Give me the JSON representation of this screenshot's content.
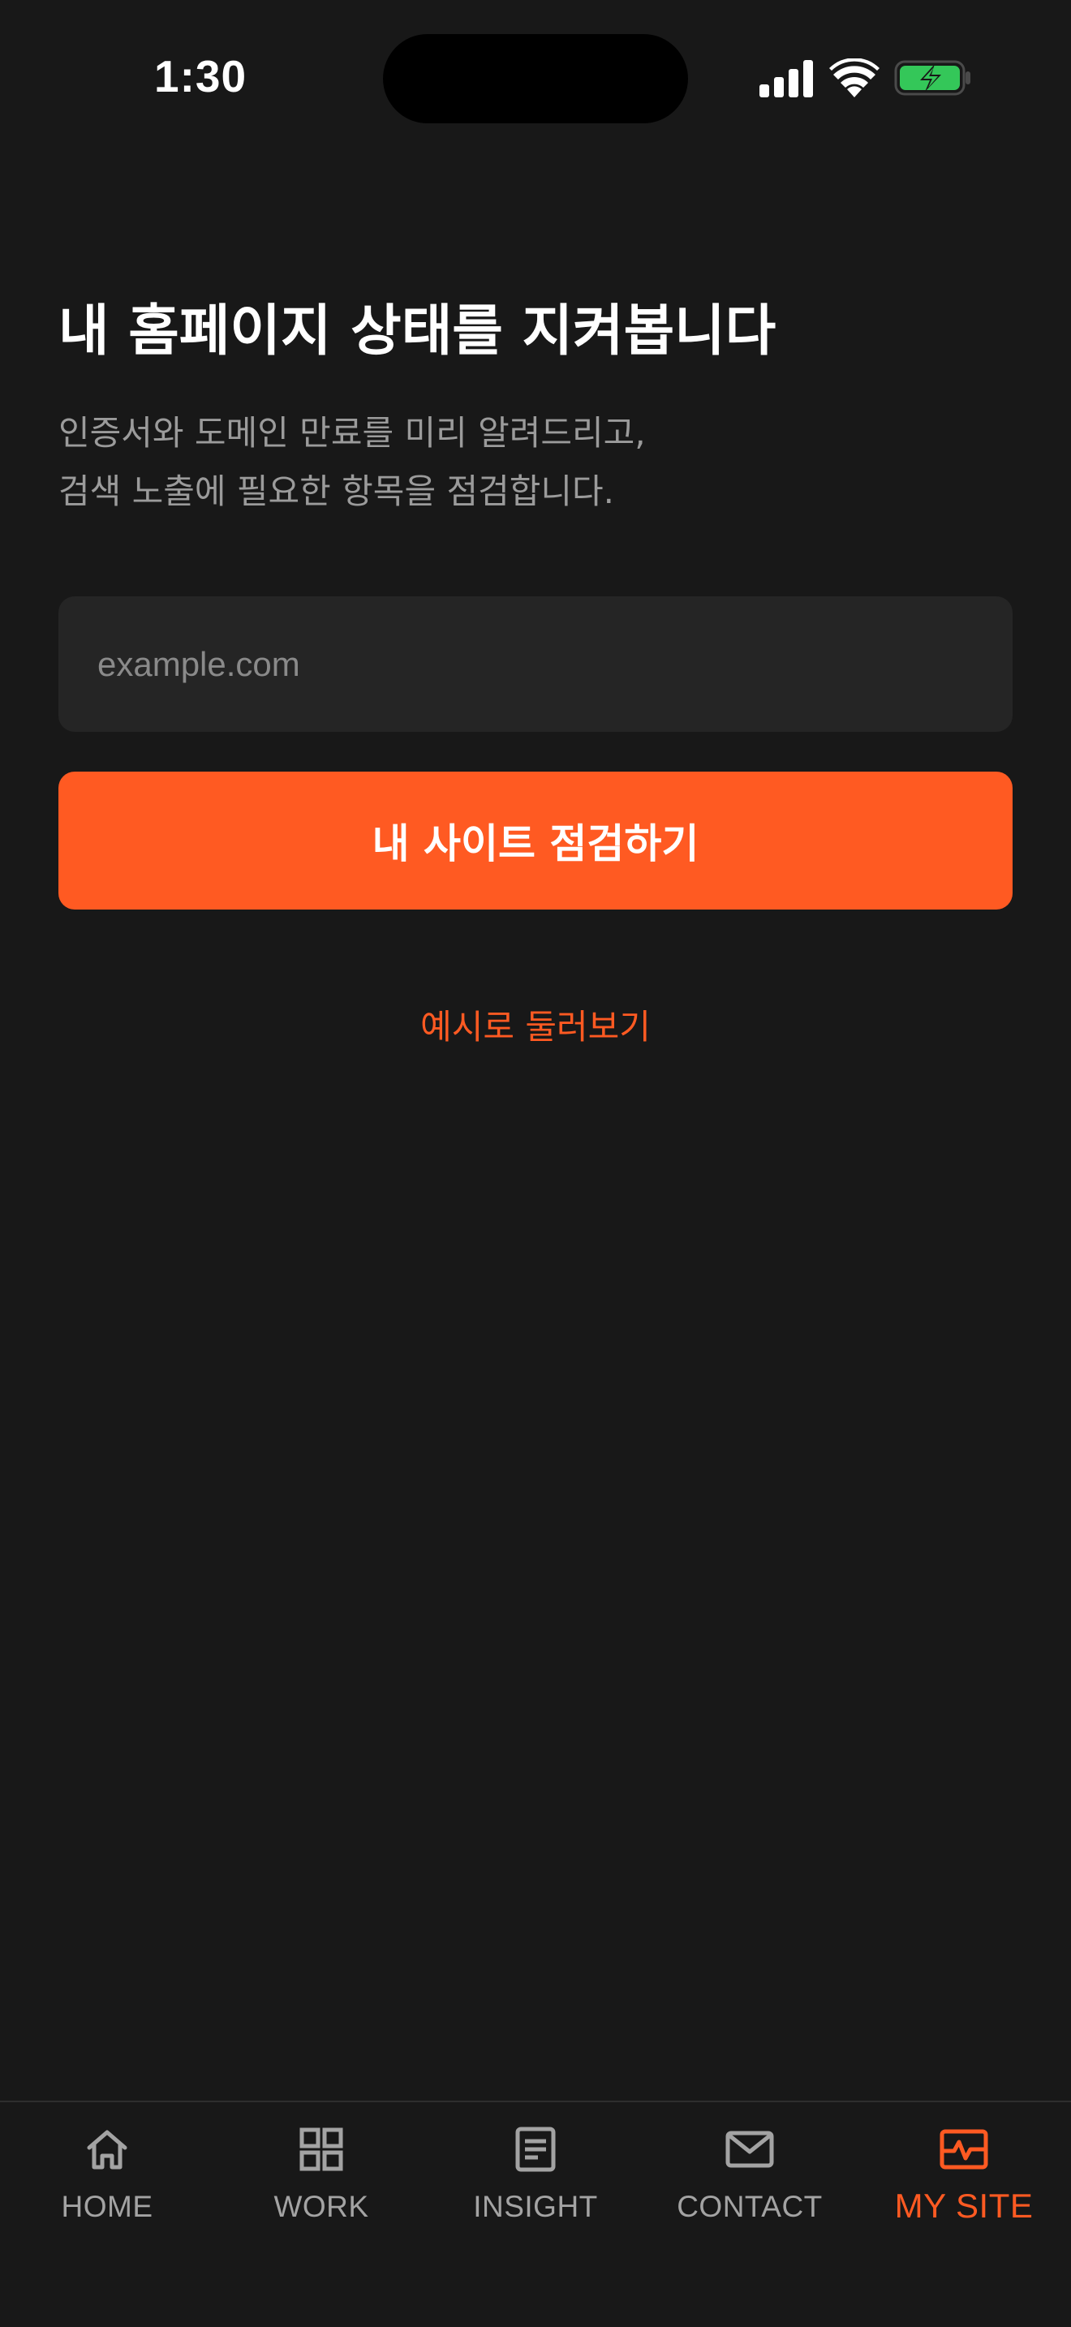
{
  "status_bar": {
    "time": "1:30"
  },
  "main": {
    "title": "내 홈페이지 상태를 지켜봅니다",
    "subtitle_lines": [
      "인증서와 도메인 만료를 미리 알려드리고,",
      "검색 노출에 필요한 항목을 점검합니다."
    ],
    "url_input": {
      "placeholder": "example.com",
      "value": ""
    },
    "check_button_label": "내 사이트 점검하기",
    "preview_link_label": "예시로 둘러보기"
  },
  "bottom_nav": {
    "items": [
      {
        "label": "HOME",
        "icon": "home-icon",
        "active": false
      },
      {
        "label": "WORK",
        "icon": "grid-icon",
        "active": false
      },
      {
        "label": "INSIGHT",
        "icon": "document-icon",
        "active": false
      },
      {
        "label": "CONTACT",
        "icon": "mail-icon",
        "active": false
      },
      {
        "label": "MY SITE",
        "icon": "site-monitor-icon",
        "active": true
      }
    ]
  },
  "colors": {
    "background": "#181818",
    "accent": "#ff5a22",
    "input_background": "#252525",
    "muted_text": "#9b9b9b",
    "battery_fill": "#34c759"
  }
}
